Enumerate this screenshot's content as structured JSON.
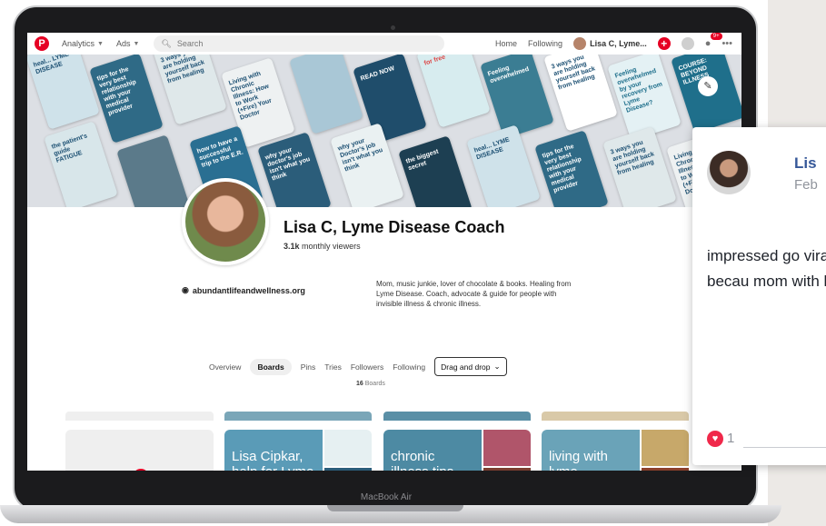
{
  "topbar": {
    "nav": [
      {
        "label": "Analytics"
      },
      {
        "label": "Ads"
      }
    ],
    "search_placeholder": "Search",
    "links": [
      "Home",
      "Following"
    ],
    "user_label": "Lisa C, Lyme...",
    "notification_badge": "9+"
  },
  "cover_tiles": [
    {
      "text": "heal... LYME DISEASE",
      "bg": "#cfe2ea",
      "fg": "#1b4f72"
    },
    {
      "text": "tips for the very best relationship with your medical provider",
      "bg": "#2f6a86",
      "fg": "#ffffff"
    },
    {
      "text": "3 ways you are holding yourself back from healing",
      "bg": "#dfe8ea",
      "fg": "#1b4f72"
    },
    {
      "text": "Living with Chronic Illness: How to Work (+Fire) Your Doctor",
      "bg": "#eef1f2",
      "fg": "#1b4f72"
    },
    {
      "text": "",
      "bg": "#a9c7d6",
      "fg": "#ffffff"
    },
    {
      "text": "READ NOW",
      "bg": "#1f4d6b",
      "fg": "#ffffff"
    },
    {
      "text": "for free",
      "bg": "#d7ecef",
      "fg": "#d44"
    },
    {
      "text": "Feeling overwhelmed",
      "bg": "#3b7d93",
      "fg": "#ffffff"
    },
    {
      "text": "3 ways you are holding yourself back from healing",
      "bg": "#ffffff",
      "fg": "#1b4f72"
    },
    {
      "text": "Feeling overwhelmed by your recovery from Lyme Disease?",
      "bg": "#e4f1f4",
      "fg": "#1b6d8a"
    },
    {
      "text": "COURSE: BEYOND ILLNESS",
      "bg": "#1f6f8b",
      "fg": "#ffffff"
    },
    {
      "text": "the patient's guide FATIGUE",
      "bg": "#d8e6ea",
      "fg": "#1b4f72"
    },
    {
      "text": "",
      "bg": "#5b7a8a",
      "fg": "#ffffff"
    },
    {
      "text": "how to have a successful trip to the E.R.",
      "bg": "#2a6f92",
      "fg": "#ffffff"
    },
    {
      "text": "why your doctor's job isn't what you think",
      "bg": "#2b5d7a",
      "fg": "#ffffff"
    },
    {
      "text": "why your Doctor's job isn't what you think",
      "bg": "#eaf1f2",
      "fg": "#1b4f72"
    },
    {
      "text": "the biggest secret",
      "bg": "#1d3f52",
      "fg": "#ffffff"
    }
  ],
  "profile": {
    "name": "Lisa C, Lyme Disease Coach",
    "viewers_count": "3.1k",
    "viewers_label": "monthly viewers",
    "website": "abundantlifeandwellness.org",
    "bio": "Mom, music junkie, lover of chocolate & books. Healing from Lyme Disease. Coach, advocate & guide for people with invisible illness & chronic illness."
  },
  "tabs": [
    {
      "label": "Overview",
      "active": false
    },
    {
      "label": "Boards",
      "active": true
    },
    {
      "label": "Pins",
      "active": false
    },
    {
      "label": "Tries",
      "active": false
    },
    {
      "label": "Followers",
      "active": false
    },
    {
      "label": "Following",
      "active": false
    }
  ],
  "sort_dropdown": "Drag and drop",
  "boards_count": "16",
  "boards_count_label": "Boards",
  "boards": [
    {
      "caption": "Lisa Cipkar, help for Lyme + Chronic Illness",
      "main_bg": "#5a9bb7",
      "side1_bg": "#e6f0f2",
      "side2_bg": "#2b5d7a",
      "peek_bg": "#7aa6b8"
    },
    {
      "caption": "chronic illness tips",
      "main_bg": "#4d8aa3",
      "side1_bg": "#b0556a",
      "side2_bg": "#7a3d2f",
      "peek_bg": "#5a8fa6"
    },
    {
      "caption": "living with lyme",
      "main_bg": "#6aa3b8",
      "side1_bg": "#c7a86a",
      "side2_bg": "#8a3f2b",
      "peek_bg": "#d9c9a8"
    }
  ],
  "facebook": {
    "name": "Lis",
    "date": "Feb",
    "text": "impressed go viral and is growing. too – becau mom with l",
    "reaction_count": "1"
  },
  "laptop_label": "MacBook Air"
}
